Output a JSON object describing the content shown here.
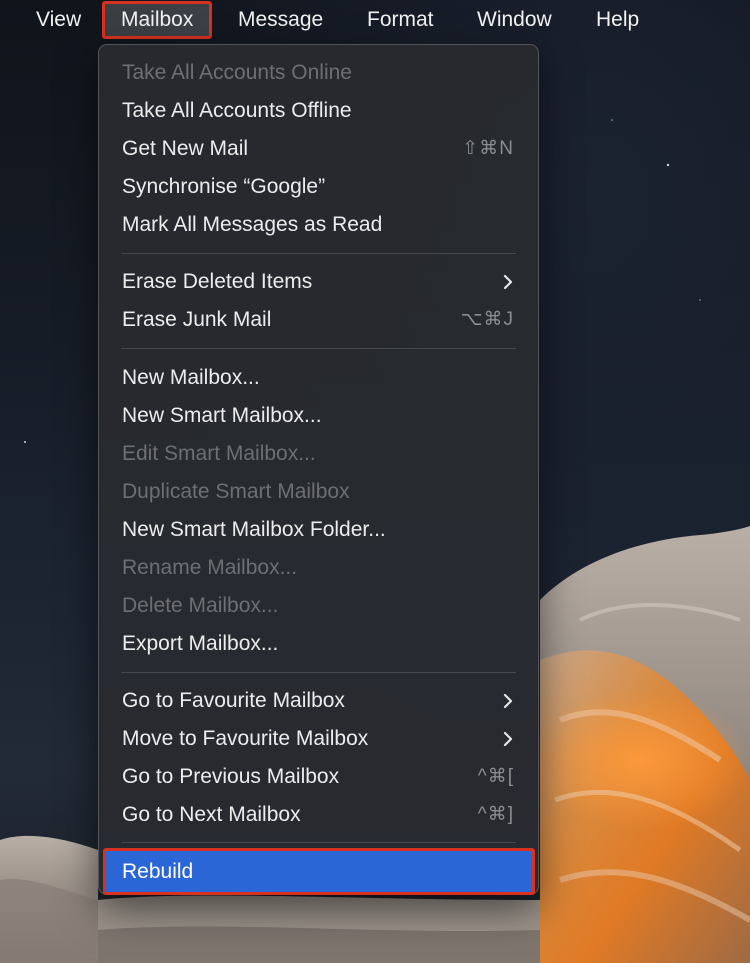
{
  "menubar": {
    "items": [
      {
        "label": "View"
      },
      {
        "label": "Mailbox"
      },
      {
        "label": "Message"
      },
      {
        "label": "Format"
      },
      {
        "label": "Window"
      },
      {
        "label": "Help"
      }
    ],
    "active_item": "Mailbox",
    "highlight_color": "#d7321f"
  },
  "mailbox_menu": {
    "items": [
      {
        "label": "Take All Accounts Online",
        "enabled": false,
        "shortcut": ""
      },
      {
        "label": "Take All Accounts Offline",
        "enabled": true,
        "shortcut": ""
      },
      {
        "label": "Get New Mail",
        "enabled": true,
        "shortcut": "⇧⌘N"
      },
      {
        "label": "Synchronise “Google”",
        "enabled": true,
        "shortcut": ""
      },
      {
        "label": "Mark All Messages as Read",
        "enabled": true,
        "shortcut": ""
      },
      {
        "label": "Erase Deleted Items",
        "enabled": true,
        "submenu": true
      },
      {
        "label": "Erase Junk Mail",
        "enabled": true,
        "shortcut": "⌥⌘J"
      },
      {
        "label": "New Mailbox...",
        "enabled": true,
        "shortcut": ""
      },
      {
        "label": "New Smart Mailbox...",
        "enabled": true,
        "shortcut": ""
      },
      {
        "label": "Edit Smart Mailbox...",
        "enabled": false,
        "shortcut": ""
      },
      {
        "label": "Duplicate Smart Mailbox",
        "enabled": false,
        "shortcut": ""
      },
      {
        "label": "New Smart Mailbox Folder...",
        "enabled": true,
        "shortcut": ""
      },
      {
        "label": "Rename Mailbox...",
        "enabled": false,
        "shortcut": ""
      },
      {
        "label": "Delete Mailbox...",
        "enabled": false,
        "shortcut": ""
      },
      {
        "label": "Export Mailbox...",
        "enabled": true,
        "shortcut": ""
      },
      {
        "label": "Go to Favourite Mailbox",
        "enabled": true,
        "submenu": true
      },
      {
        "label": "Move to Favourite Mailbox",
        "enabled": true,
        "submenu": true
      },
      {
        "label": "Go to Previous Mailbox",
        "enabled": true,
        "shortcut": "^⌘["
      },
      {
        "label": "Go to Next Mailbox",
        "enabled": true,
        "shortcut": "^⌘]"
      },
      {
        "label": "Rebuild",
        "enabled": true,
        "selected": true,
        "shortcut": ""
      }
    ],
    "selected_color": "#2a66d6"
  }
}
